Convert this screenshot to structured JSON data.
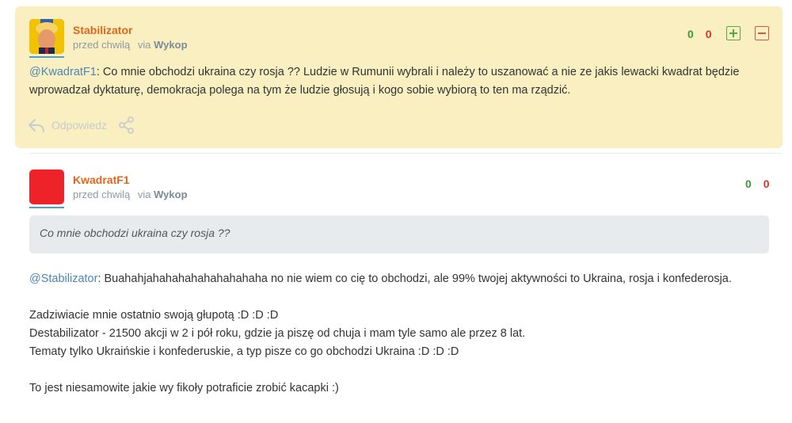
{
  "comments": [
    {
      "username": "Stabilizator",
      "time": "przed chwilą",
      "via_prefix": "via",
      "via_source": "Wykop",
      "votes_plus": "0",
      "votes_minus": "0",
      "mention": "@KwadratF1",
      "text": ": Co mnie obchodzi ukraina czy rosja ?? Ludzie w Rumunii wybrali i należy to uszanować a nie ze jakis lewacki kwadrat będzie wprowadzał dyktaturę, demokracja polega na tym że ludzie głosują i kogo sobie wybiorą to ten ma rządzić.",
      "reply_label": "Odpowiedz",
      "avatar_color": "#2f5fae"
    },
    {
      "username": "KwadratF1",
      "time": "przed chwilą",
      "via_prefix": "via",
      "via_source": "Wykop",
      "votes_plus": "0",
      "votes_minus": "0",
      "quote": "Co mnie obchodzi ukraina czy rosja ??",
      "mention": "@Stabilizator",
      "line1": ": Buahahjahahahahahahahahaha no nie wiem co cię to obchodzi, ale 99% twojej aktywności to Ukraina, rosja i konfederosja.",
      "line2": "Zadziwiacie mnie ostatnio swoją głupotą :D :D :D",
      "line3": "Destabilizator - 21500 akcji w 2 i pół roku, gdzie ja piszę od chuja i mam tyle samo ale przez 8 lat.",
      "line4": "Tematy tylko Ukraińskie i konfederuskie, a typ pisze co go obchodzi Ukraina :D :D :D",
      "line5": "To jest niesamowite jakie wy fikoły potraficie zrobić kacapki :)",
      "avatar_color": "#ee2229"
    }
  ],
  "colors": {
    "highlight_bg": "#f9efc1",
    "username": "#e0661c",
    "mention": "#4b87b8",
    "plus": "#3b9c3b",
    "minus": "#d9342b"
  },
  "icons": {
    "reply": "reply-arrow-icon",
    "share": "share-icon",
    "vote_up": "plus-box-icon",
    "vote_down": "minus-box-icon"
  }
}
